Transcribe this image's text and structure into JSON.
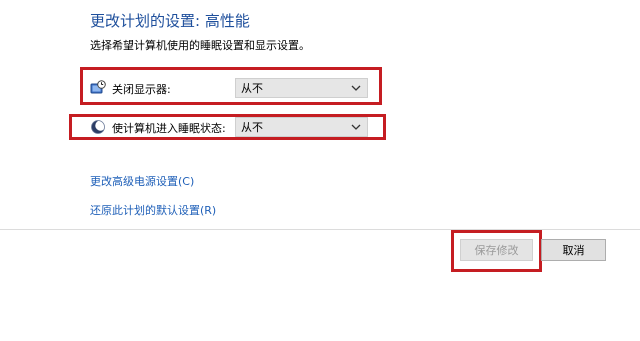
{
  "header": {
    "title": "更改计划的设置: 高性能",
    "subtitle": "选择希望计算机使用的睡眠设置和显示设置。"
  },
  "settings": {
    "display_off": {
      "label": "关闭显示器:",
      "value": "从不",
      "icon": "monitor-clock-icon"
    },
    "sleep": {
      "label": "使计算机进入睡眠状态:",
      "value": "从不",
      "icon": "moon-icon"
    }
  },
  "links": {
    "advanced": "更改高级电源设置(C)",
    "restore": "还原此计划的默认设置(R)"
  },
  "buttons": {
    "save": "保存修改",
    "cancel": "取消"
  },
  "colors": {
    "title": "#1e4f9c",
    "link": "#1e5fb8",
    "highlight": "#c51d22",
    "disabled_text": "#9a9a9a"
  }
}
